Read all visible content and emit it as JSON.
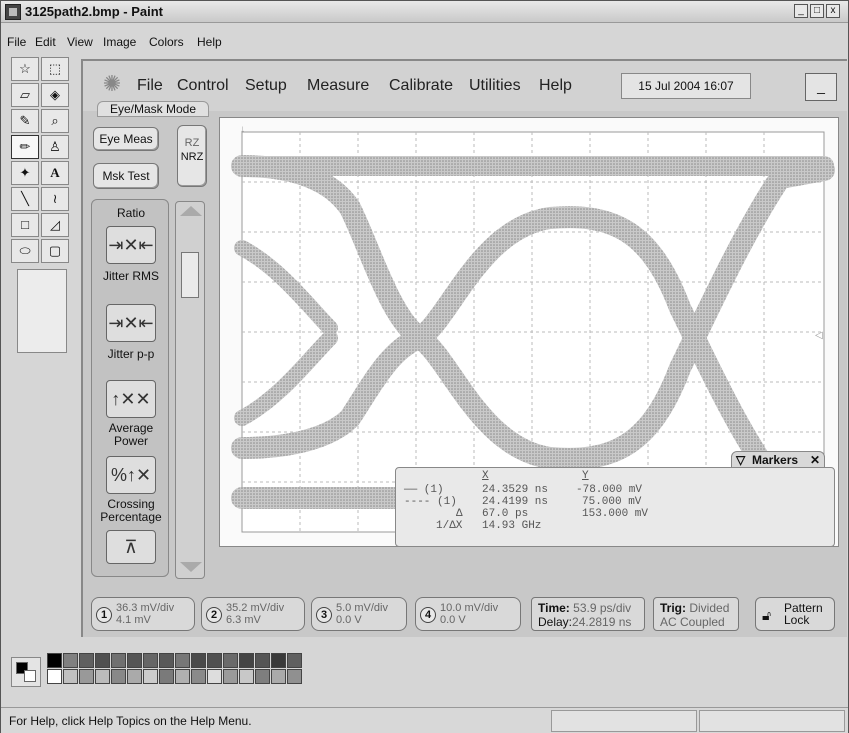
{
  "window": {
    "title": "3125path2.bmp - Paint",
    "controls": [
      "_",
      "□",
      "x"
    ]
  },
  "menu": [
    "File",
    "Edit",
    "View",
    "Image",
    "Colors",
    "Help"
  ],
  "status_bar": {
    "text": "For Help, click Help Topics on the Help Menu."
  },
  "scope": {
    "menus": [
      "File",
      "Control",
      "Setup",
      "Measure",
      "Calibrate",
      "Utilities",
      "Help"
    ],
    "datetime": "15 Jul 2004  16:07",
    "minimize_label": "_",
    "mode_label": "Eye/Mask Mode",
    "eye_meas_label": "Eye Meas",
    "mask_test_label": "Msk Test",
    "rz_label": "RZ",
    "nrz_label": "NRZ",
    "measure_panel_title": "Ratio",
    "measurements": [
      {
        "label": "Jitter RMS",
        "icon": "jitter-rms-icon"
      },
      {
        "label": "Jitter p-p",
        "icon": "jitter-pp-icon"
      },
      {
        "label": "Average Power",
        "icon": "average-power-icon"
      },
      {
        "label": "Crossing Percentage",
        "icon": "crossing-percentage-icon"
      },
      {
        "label": "",
        "icon": "more-measure-icon"
      }
    ],
    "markers": {
      "title": "Markers",
      "header_x": "X",
      "header_y": "Y",
      "rows": [
        {
          "label": "—— (1)",
          "x": "24.3529 ns",
          "y": "-78.000 mV"
        },
        {
          "label": "---- (1)",
          "x": "24.4199 ns",
          "y": "75.000 mV"
        },
        {
          "label": "Δ",
          "x": "67.0 ps",
          "y": "153.000 mV"
        },
        {
          "label": "1/ΔX",
          "x": "14.93 GHz",
          "y": ""
        }
      ]
    },
    "channels": [
      {
        "num": "1",
        "scale": "36.3 mV/div",
        "offset": "4.1 mV"
      },
      {
        "num": "2",
        "scale": "35.2 mV/div",
        "offset": "6.3 mV"
      },
      {
        "num": "3",
        "scale": "5.0 mV/div",
        "offset": "0.0 V"
      },
      {
        "num": "4",
        "scale": "10.0 mV/div",
        "offset": "0.0 V"
      }
    ],
    "timebase": {
      "line1_label": "Time:",
      "line1_value": "53.9 ps/div",
      "line2_label": "Delay:",
      "line2_value": "24.2819 ns"
    },
    "trigger": {
      "line1_label": "Trig:",
      "line1_value": "Divided",
      "line2": "AC Coupled"
    },
    "pattern_lock": {
      "line1": "Pattern",
      "line2": "Lock"
    }
  },
  "colors": {
    "accent": "#d6d6d6",
    "trace": "#9a9a9a"
  }
}
